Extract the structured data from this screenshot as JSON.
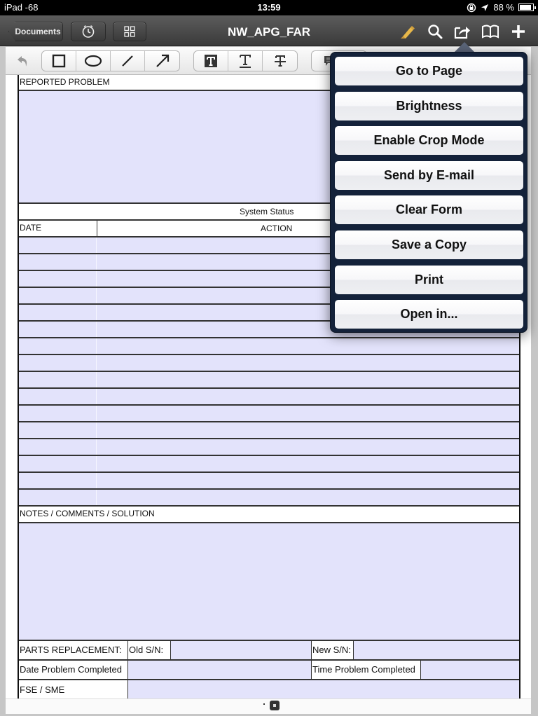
{
  "status_bar": {
    "carrier": "iPad -68",
    "time": "13:59",
    "battery_text": "88 %",
    "battery_level": 0.88
  },
  "nav_bar": {
    "back_label": "Documents",
    "title": "NW_APG_FAR",
    "icons": [
      "clock-icon",
      "grid-icon",
      "highlighter-icon",
      "search-icon",
      "share-icon",
      "book-icon",
      "plus-icon"
    ]
  },
  "toolbar": {
    "tools": [
      "undo",
      "rectangle",
      "ellipse",
      "line",
      "arrow",
      "text-box",
      "underline-text",
      "strikeout-text",
      "comment"
    ]
  },
  "form": {
    "reported_problem_label": "REPORTED PROBLEM",
    "system_status_label": "System Status",
    "date_header": "DATE",
    "action_header": "ACTION",
    "log_row_count": 16,
    "notes_label": "NOTES / COMMENTS / SOLUTION",
    "parts_replacement_label": "PARTS REPLACEMENT:",
    "old_sn_label": "Old S/N:",
    "new_sn_label": "New S/N:",
    "date_completed_label": "Date Problem Completed",
    "time_completed_label": "Time Problem Completed",
    "fse_sme_label": "FSE / SME"
  },
  "popover_menu": {
    "items": [
      {
        "label": "Go to Page"
      },
      {
        "label": "Brightness"
      },
      {
        "label": "Enable Crop Mode"
      },
      {
        "label": "Send by E-mail"
      },
      {
        "label": "Clear Form"
      },
      {
        "label": "Save a Copy"
      },
      {
        "label": "Print"
      },
      {
        "label": "Open in..."
      }
    ]
  },
  "colors": {
    "field_fill": "#e3e3fb",
    "popover_bg": "#14223a",
    "highlighter": "#e8b84a"
  }
}
